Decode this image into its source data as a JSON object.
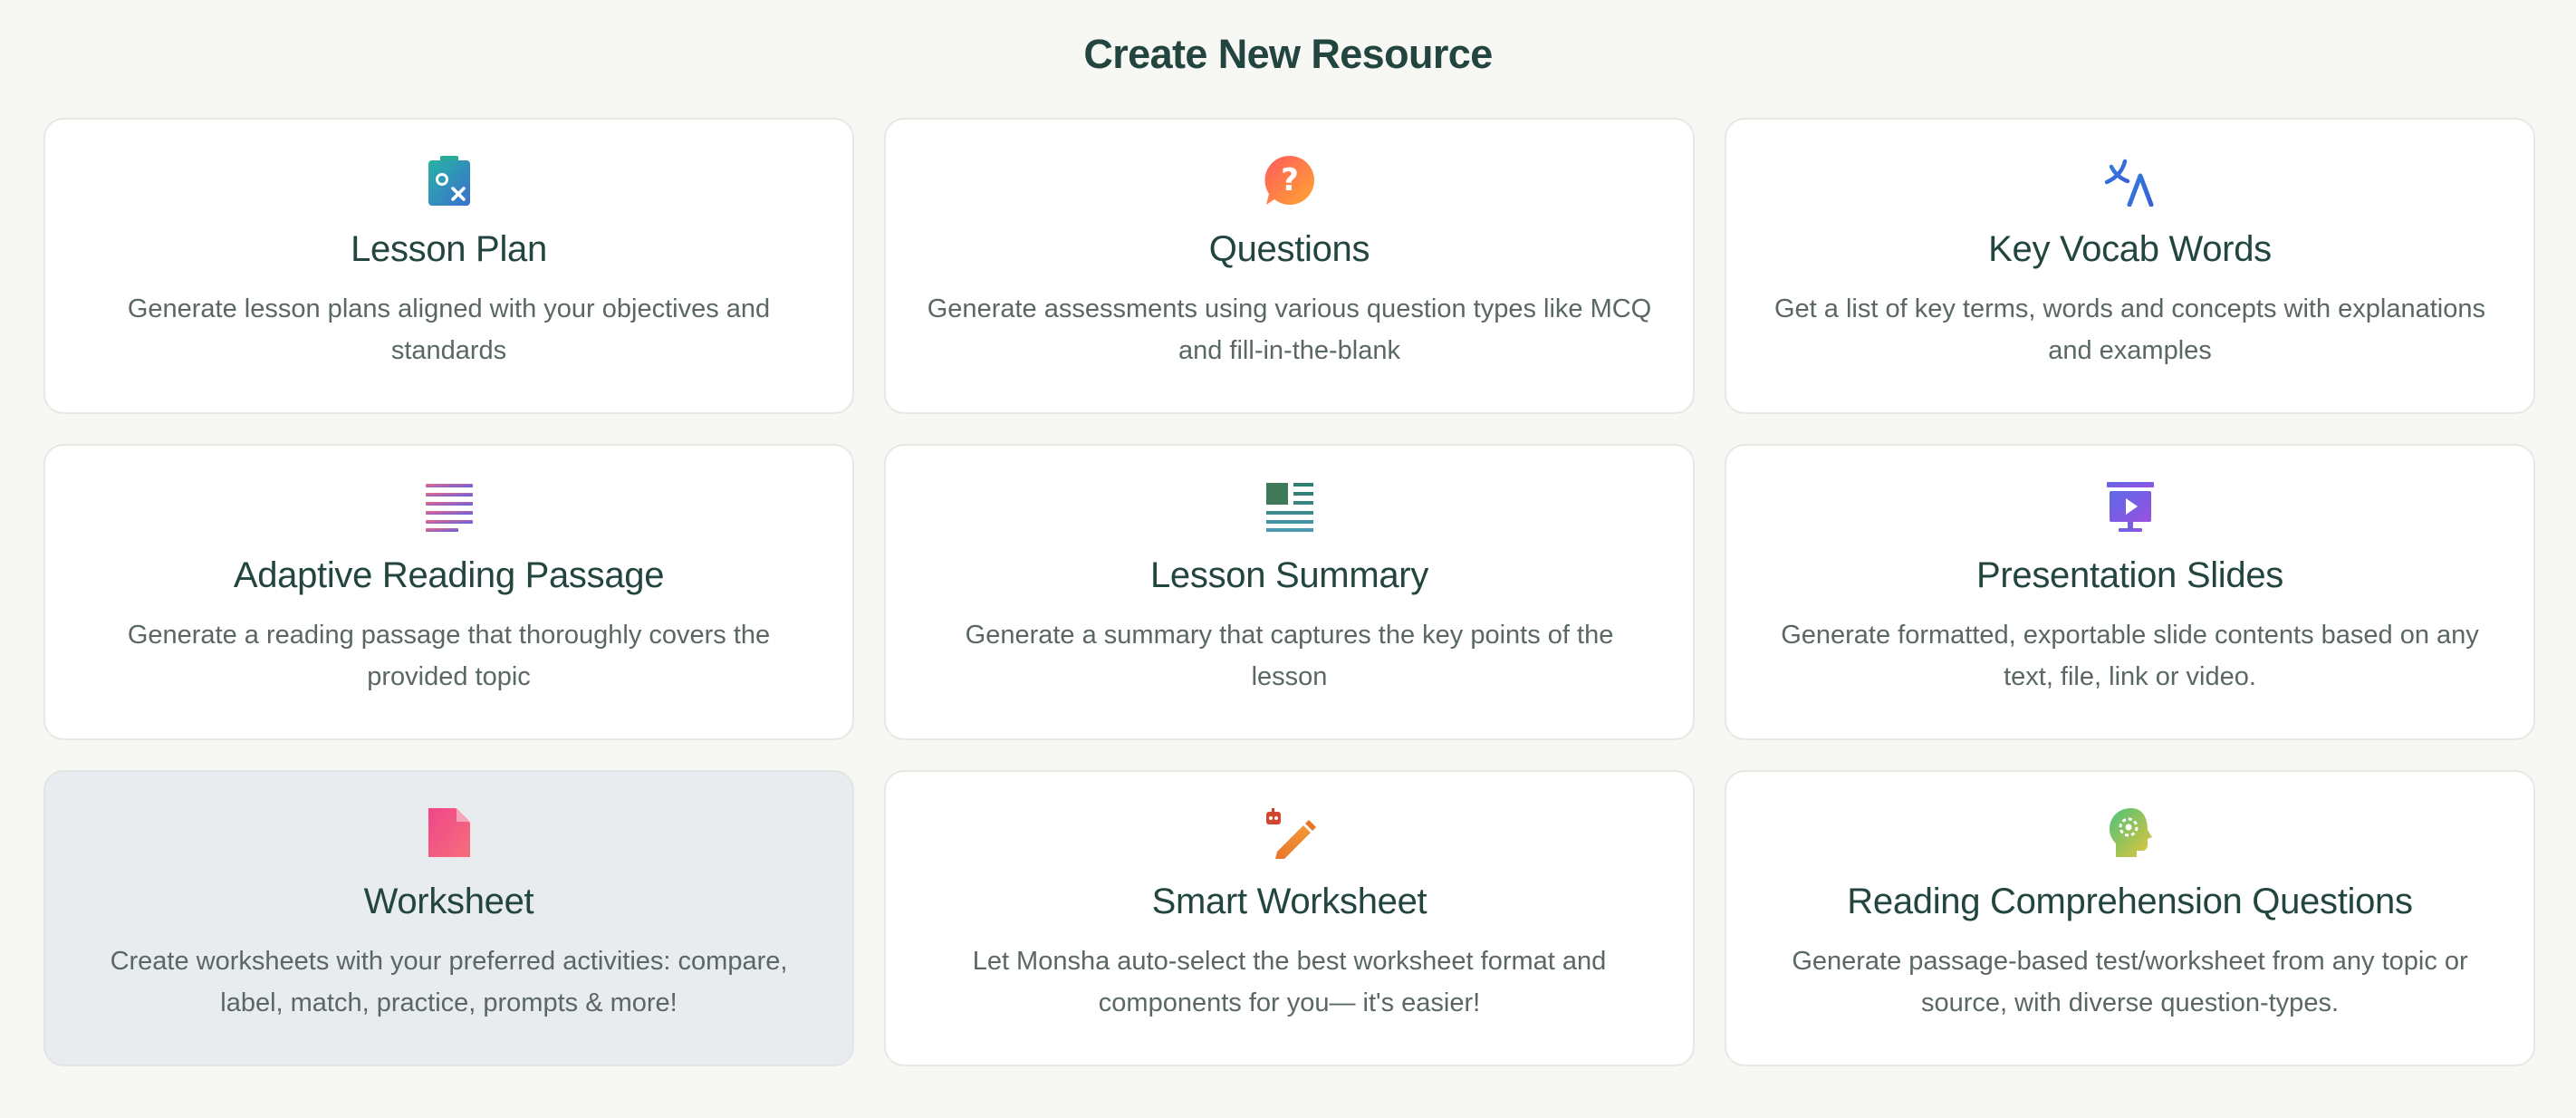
{
  "page": {
    "title": "Create New Resource"
  },
  "theme": {
    "background": "#f7f7f4",
    "card_background": "#ffffff",
    "selected_card_background": "#e8ecee",
    "title_color": "#234540",
    "text_color": "#5a6764"
  },
  "cards": [
    {
      "title": "Lesson Plan",
      "description": "Generate lesson plans aligned with your objectives and standards",
      "icon": "clipboard-icon",
      "selected": false
    },
    {
      "title": "Questions",
      "description": "Generate assessments using various question types like MCQ and fill-in-the-blank",
      "icon": "question-bubble-icon",
      "selected": false
    },
    {
      "title": "Key Vocab Words",
      "description": "Get a list of key terms, words and concepts with explanations and examples",
      "icon": "translate-icon",
      "selected": false
    },
    {
      "title": "Adaptive Reading Passage",
      "description": "Generate a reading passage that thoroughly covers the provided topic",
      "icon": "text-lines-icon",
      "selected": false
    },
    {
      "title": "Lesson Summary",
      "description": "Generate a summary that captures the key points of the lesson",
      "icon": "article-icon",
      "selected": false
    },
    {
      "title": "Presentation Slides",
      "description": "Generate formatted, exportable slide contents based on any text, file, link or video.",
      "icon": "presentation-icon",
      "selected": false
    },
    {
      "title": "Worksheet",
      "description": "Create worksheets with your preferred activities: compare, label, match, practice, prompts & more!",
      "icon": "document-icon",
      "selected": true
    },
    {
      "title": "Smart Worksheet",
      "description": "Let Monsha auto-select the best worksheet format and components for you— it's easier!",
      "icon": "robot-pencil-icon",
      "selected": false
    },
    {
      "title": "Reading Comprehension Questions",
      "description": "Generate passage-based test/worksheet from any topic or source, with diverse question-types.",
      "icon": "brain-head-icon",
      "selected": false
    }
  ]
}
